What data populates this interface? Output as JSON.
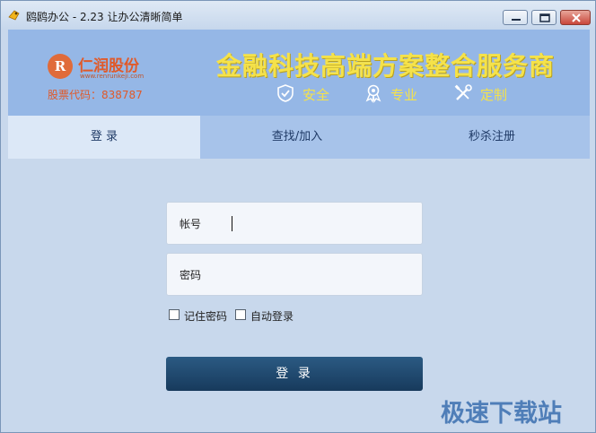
{
  "window": {
    "title": "鸥鸥办公 - 2.23 让办公清晰简单",
    "app_icon": "app-logo-icon",
    "controls": [
      "minimize-icon",
      "maximize-icon",
      "close-icon"
    ]
  },
  "header": {
    "logo_mark": "R",
    "company_name": "仁润股份",
    "company_url": "www.renrunkeji.com",
    "stock_code": "股票代码：838787",
    "slogan": "金融科技高端方案整合服务商",
    "features": [
      {
        "icon": "shield-check-icon",
        "label": "安全"
      },
      {
        "icon": "award-ribbon-icon",
        "label": "专业"
      },
      {
        "icon": "tools-icon",
        "label": "定制"
      }
    ]
  },
  "tabs": [
    {
      "label": "登 录",
      "active": true
    },
    {
      "label": "查找/加入",
      "active": false
    },
    {
      "label": "秒杀注册",
      "active": false
    }
  ],
  "form": {
    "account_label": "帐号",
    "account_value": "",
    "password_label": "密码",
    "password_value": "",
    "remember_password": {
      "label": "记住密码",
      "checked": false
    },
    "auto_login": {
      "label": "自动登录",
      "checked": false
    },
    "login_button": "登 录"
  },
  "watermark": "极速下载站",
  "colors": {
    "header_bg": "#95b7e6",
    "slogan": "#f5e24a",
    "brand_orange": "#e05a2a",
    "tab_active_bg": "#dce8f7",
    "panel_bg": "#c8d8ec",
    "login_button": "#1f4a70"
  }
}
